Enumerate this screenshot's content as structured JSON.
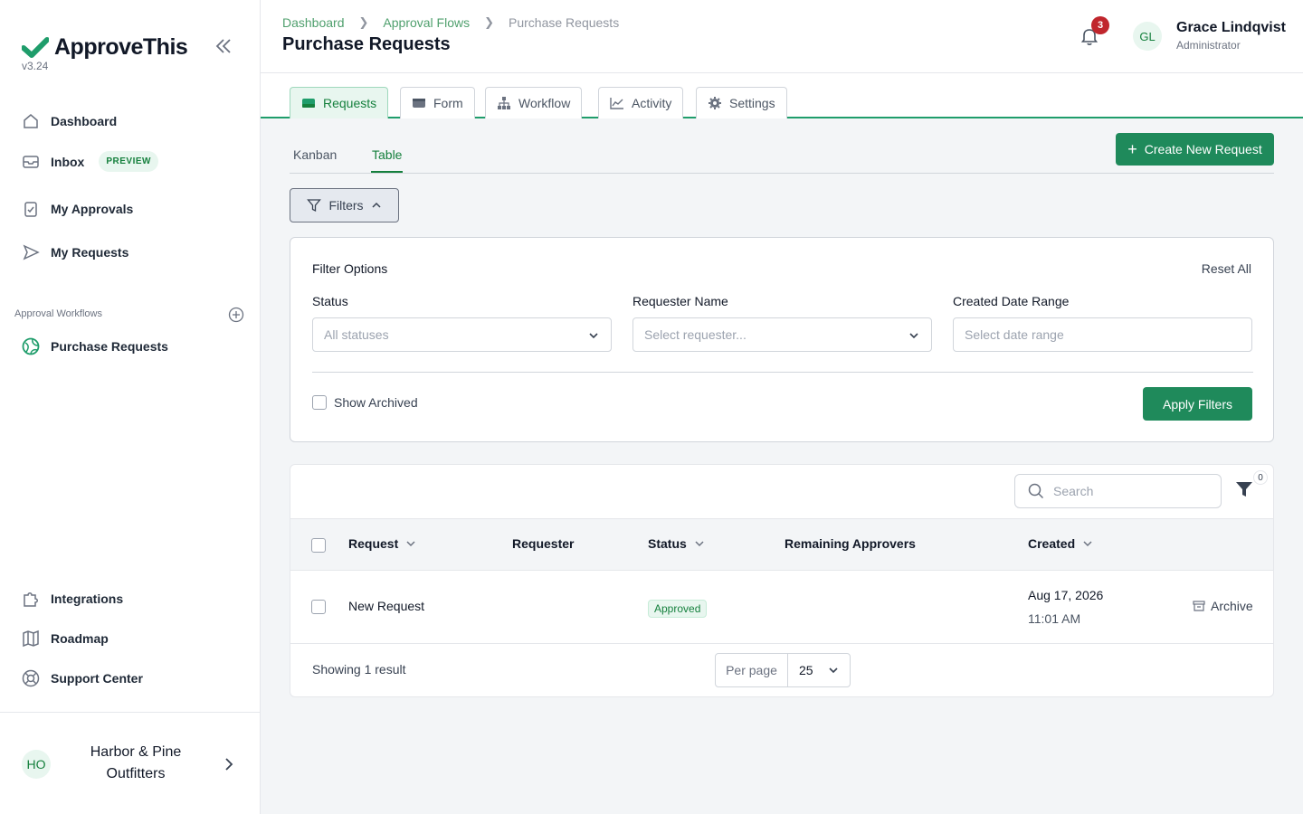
{
  "app": {
    "name": "ApproveThis",
    "version": "v3.24"
  },
  "sidebar": {
    "nav": [
      {
        "label": "Dashboard",
        "icon": "home-icon"
      },
      {
        "label": "Inbox",
        "icon": "inbox-icon",
        "badge": "PREVIEW"
      },
      {
        "label": "My Approvals",
        "icon": "clipboard-check-icon"
      },
      {
        "label": "My Requests",
        "icon": "send-icon"
      }
    ],
    "section_label": "Approval Workflows",
    "workflows": [
      {
        "label": "Purchase Requests",
        "icon": "globe-icon"
      }
    ],
    "bottom": [
      {
        "label": "Integrations",
        "icon": "puzzle-icon"
      },
      {
        "label": "Roadmap",
        "icon": "map-icon"
      },
      {
        "label": "Support Center",
        "icon": "lifebuoy-icon"
      }
    ],
    "workspace": {
      "initials": "HO",
      "name": "Harbor & Pine Outfitters"
    }
  },
  "header": {
    "breadcrumb": [
      "Dashboard",
      "Approval Flows",
      "Purchase Requests"
    ],
    "title": "Purchase Requests",
    "notifications": "3",
    "user": {
      "initials": "GL",
      "name": "Grace Lindqvist",
      "role": "Administrator"
    }
  },
  "tabs": [
    "Requests",
    "Form",
    "Workflow",
    "Activity",
    "Settings"
  ],
  "subtabs": [
    "Kanban",
    "Table"
  ],
  "create_button": "Create New Request",
  "filters": {
    "button": "Filters",
    "title": "Filter Options",
    "reset": "Reset All",
    "fields": [
      {
        "label": "Status",
        "placeholder": "All statuses"
      },
      {
        "label": "Requester Name",
        "placeholder": "Select requester..."
      },
      {
        "label": "Created Date Range",
        "placeholder": "Select date range"
      }
    ],
    "show_archived": "Show Archived",
    "apply": "Apply Filters"
  },
  "table": {
    "search_placeholder": "Search",
    "filter_count": "0",
    "columns": [
      "Request",
      "Requester",
      "Status",
      "Remaining Approvers",
      "Created"
    ],
    "rows": [
      {
        "request": "New Request",
        "requester": "",
        "status": "Approved",
        "remaining": "",
        "created_date": "Aug 17, 2026",
        "created_time": "11:01 AM",
        "action": "Archive"
      }
    ],
    "footer": "Showing 1 result",
    "per_page_label": "Per page",
    "per_page_value": "25"
  },
  "colors": {
    "brand": "#1f8a5b",
    "accent_light": "#e8f6ef",
    "badge_red": "#c0262d"
  }
}
